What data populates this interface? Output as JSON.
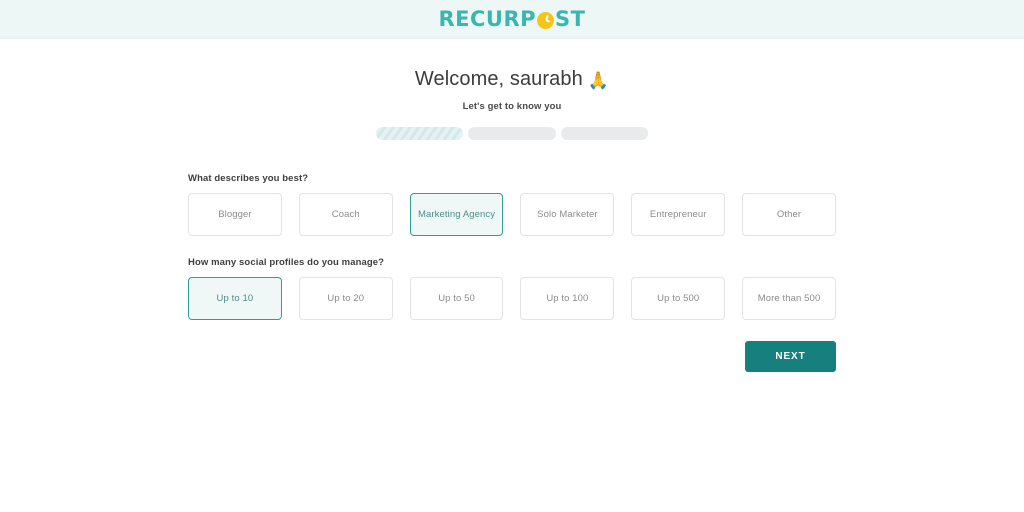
{
  "brand": {
    "logo_text_left": "RECURP",
    "logo_text_right": "ST",
    "logo_icon": "clock-icon",
    "logo_color": "#3ab6b0",
    "logo_clock_color": "#f5c518"
  },
  "header": {
    "background": "#edf7f6"
  },
  "welcome": {
    "title": "Welcome, saurabh",
    "emoji": "🙏",
    "subtitle": "Let's get to know you"
  },
  "progress": {
    "steps": [
      {
        "label": "step-1",
        "state": "active"
      },
      {
        "label": "step-2",
        "state": "inactive"
      },
      {
        "label": "step-3",
        "state": "inactive"
      }
    ],
    "active_color": "#d3e9e8",
    "inactive_color": "#e9eaec"
  },
  "questions": [
    {
      "label": "What describes you best?",
      "options": [
        {
          "label": "Blogger",
          "selected": false
        },
        {
          "label": "Coach",
          "selected": false
        },
        {
          "label": "Marketing Agency",
          "selected": true
        },
        {
          "label": "Solo Marketer",
          "selected": false
        },
        {
          "label": "Entrepreneur",
          "selected": false
        },
        {
          "label": "Other",
          "selected": false
        }
      ]
    },
    {
      "label": "How many social profiles do you manage?",
      "options": [
        {
          "label": "Up to 10",
          "selected": true
        },
        {
          "label": "Up to 20",
          "selected": false
        },
        {
          "label": "Up to 50",
          "selected": false
        },
        {
          "label": "Up to 100",
          "selected": false
        },
        {
          "label": "Up to 500",
          "selected": false
        },
        {
          "label": "More than 500",
          "selected": false
        }
      ]
    }
  ],
  "actions": {
    "next_label": "NEXT",
    "next_color": "#16807e"
  },
  "theme": {
    "selected_border": "#2f9d98",
    "selected_fill": "#f0f8f7",
    "selected_text": "#4a8d8a",
    "option_border": "#e3e3e3",
    "option_text": "#8c8c8c"
  }
}
